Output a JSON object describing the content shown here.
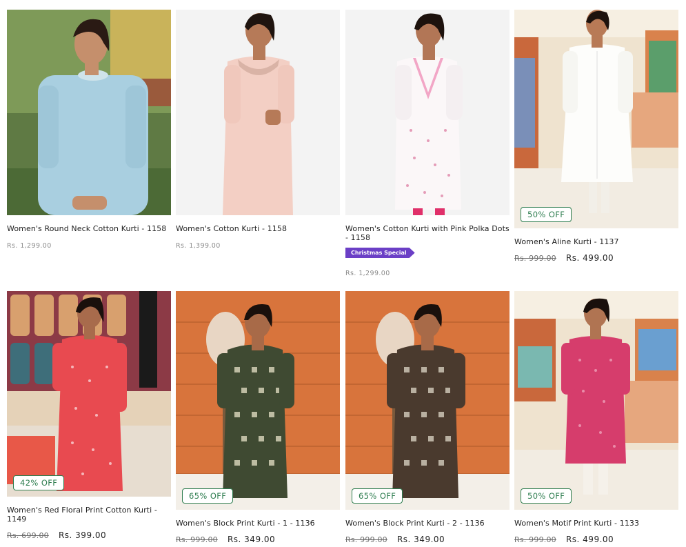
{
  "colors": {
    "badge_green": "#2e7d4f",
    "tag_purple": "#6b3fc6",
    "text": "#222222",
    "muted": "#8a8a8a"
  },
  "products": [
    {
      "title": "Women's Round Neck Cotton Kurti - 1158",
      "price": "Rs. 1,299.00",
      "discount": null,
      "old_price": null,
      "new_price": null,
      "tag": null
    },
    {
      "title": "Women's Cotton Kurti - 1158",
      "price": "Rs. 1,399.00",
      "discount": null,
      "old_price": null,
      "new_price": null,
      "tag": null
    },
    {
      "title": "Women's Cotton Kurti with Pink Polka Dots - 1158",
      "price": "Rs. 1,299.00",
      "discount": null,
      "old_price": null,
      "new_price": null,
      "tag": "Christmas Special"
    },
    {
      "title": "Women's Aline Kurti - 1137",
      "price": null,
      "discount": "50% OFF",
      "old_price": "Rs. 999.00",
      "new_price": "Rs. 499.00",
      "tag": null
    },
    {
      "title": "Women's Red Floral Print Cotton Kurti - 1149",
      "price": null,
      "discount": "42% OFF",
      "old_price": "Rs. 699.00",
      "new_price": "Rs. 399.00",
      "tag": null
    },
    {
      "title": "Women's Block Print Kurti - 1 - 1136",
      "price": null,
      "discount": "65% OFF",
      "old_price": "Rs. 999.00",
      "new_price": "Rs. 349.00",
      "tag": null
    },
    {
      "title": "Women's Block Print Kurti - 2 - 1136",
      "price": null,
      "discount": "65% OFF",
      "old_price": "Rs. 999.00",
      "new_price": "Rs. 349.00",
      "tag": null
    },
    {
      "title": "Women's Motif Print Kurti - 1133",
      "price": null,
      "discount": "50% OFF",
      "old_price": "Rs. 999.00",
      "new_price": "Rs. 499.00",
      "tag": null
    }
  ]
}
